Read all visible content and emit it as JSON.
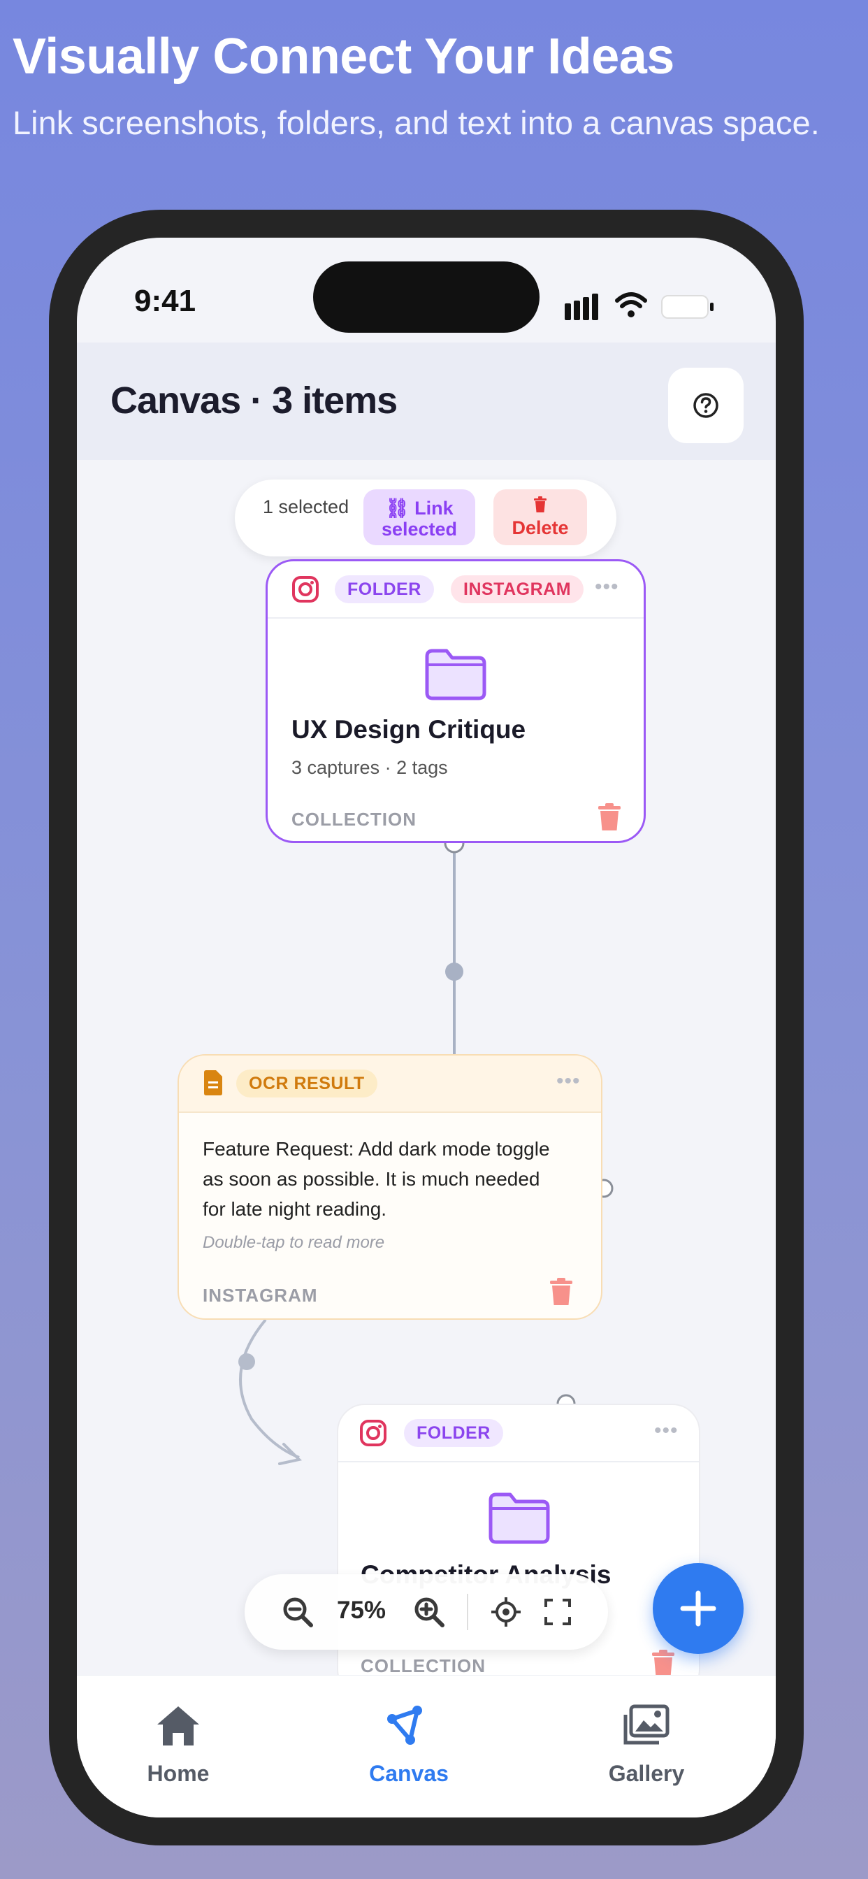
{
  "promo": {
    "headline": "Visually Connect Your Ideas",
    "subheadline": "Link screenshots, folders, and text into a canvas space."
  },
  "status_bar": {
    "time": "9:41"
  },
  "header": {
    "title": "Canvas · 3 items",
    "help_icon": "question-circle-icon"
  },
  "selection_bar": {
    "count": "1 selected",
    "link_label": "Link selected",
    "delete_label": "Delete"
  },
  "cards": [
    {
      "source_icon": "instagram-icon",
      "badges": [
        "FOLDER",
        "INSTAGRAM"
      ],
      "more": "•••",
      "icon": "folder-icon",
      "title": "UX Design Critique",
      "subtitle": "3 captures · 2 tags",
      "footer": "COLLECTION",
      "selected": true
    },
    {
      "source_icon": "document-icon",
      "badges": [
        "OCR RESULT"
      ],
      "more": "•••",
      "text": "Feature Request: Add dark mode toggle as soon as possible. It is much needed for late night reading.",
      "hint": "Double-tap to read more",
      "footer": "INSTAGRAM"
    },
    {
      "source_icon": "instagram-icon",
      "badges": [
        "FOLDER"
      ],
      "more": "•••",
      "icon": "folder-icon",
      "title": "Competitor Analysis",
      "footer": "COLLECTION"
    }
  ],
  "zoom": {
    "value": "75%"
  },
  "tabs": [
    {
      "label": "Home",
      "icon": "home-icon",
      "active": false
    },
    {
      "label": "Canvas",
      "icon": "canvas-icon",
      "active": true
    },
    {
      "label": "Gallery",
      "icon": "gallery-icon",
      "active": false
    }
  ],
  "colors": {
    "accent": "#2f7bf0",
    "folder_purple": "#9b59f5",
    "danger": "#e53535",
    "ocr_orange": "#d07a0d"
  }
}
